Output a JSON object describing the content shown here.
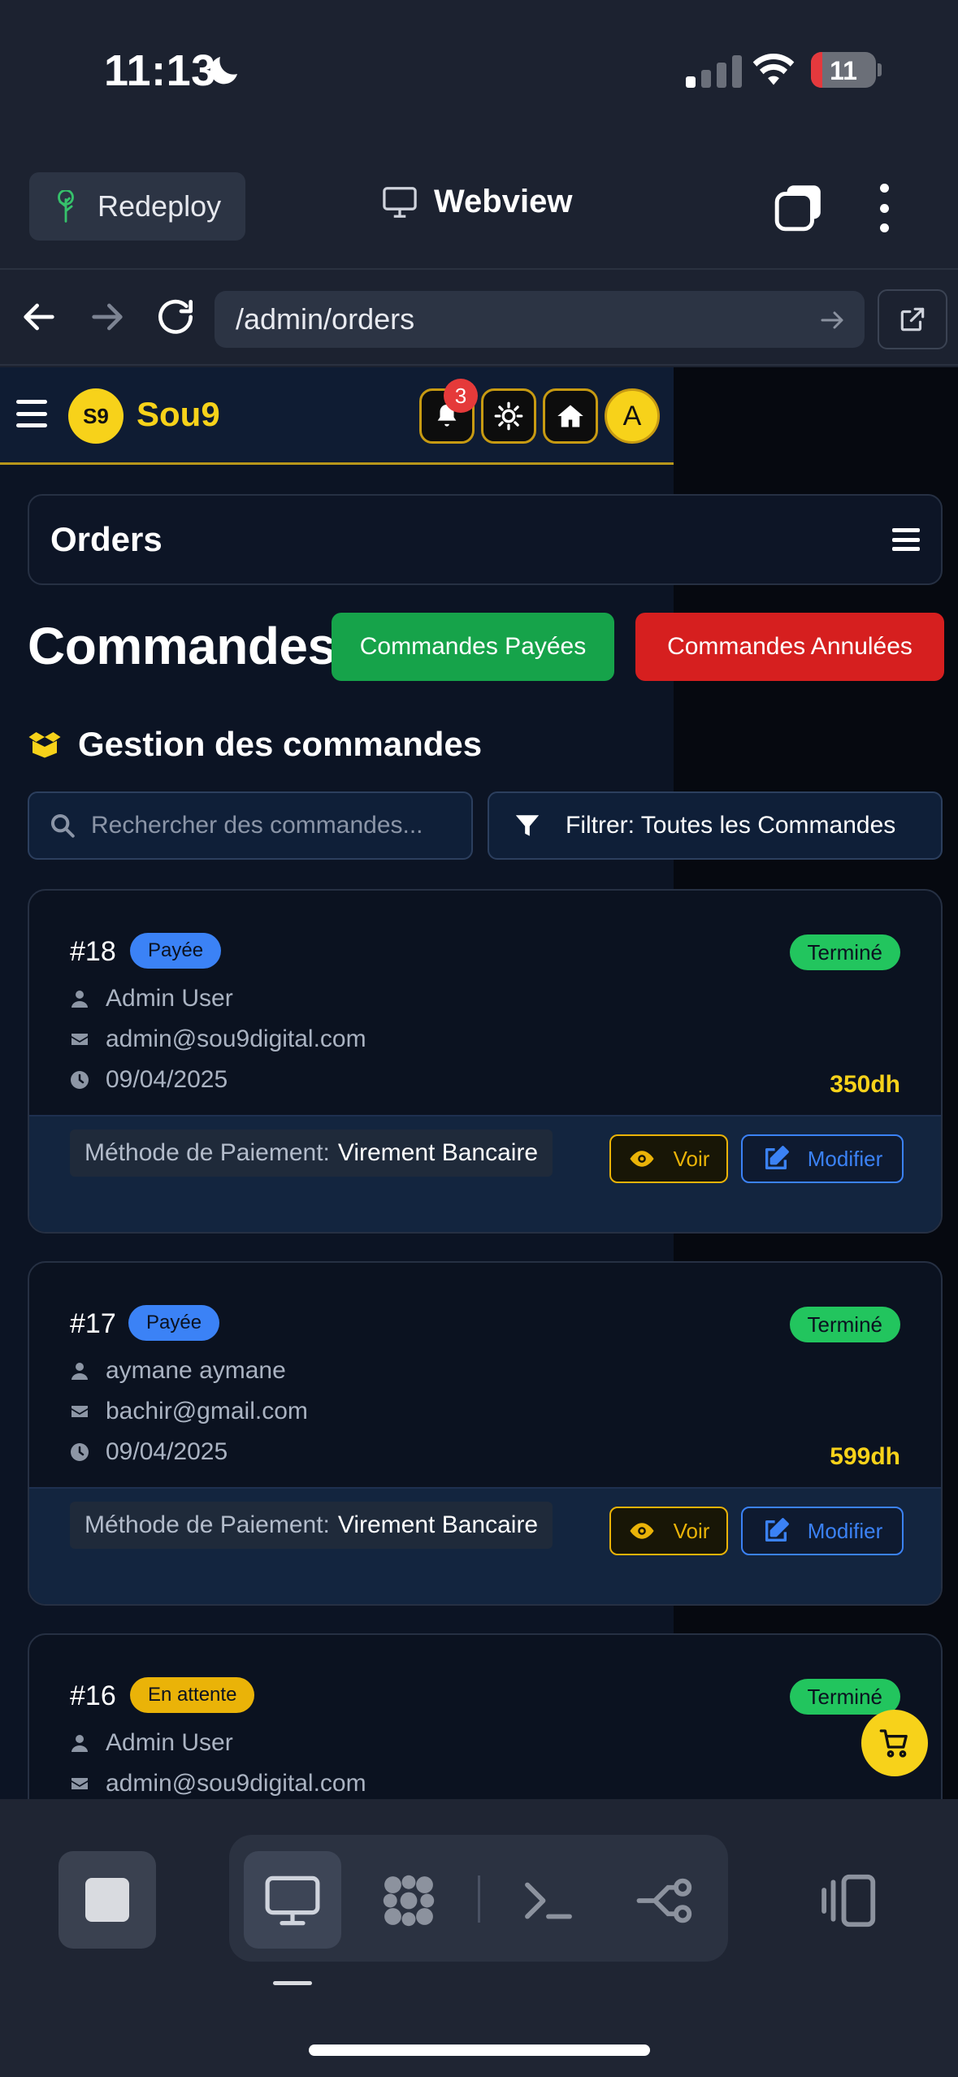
{
  "status_bar": {
    "time": "11:13",
    "battery": "11"
  },
  "app_header": {
    "redeploy_label": "Redeploy",
    "title": "Webview"
  },
  "browser": {
    "url": "/admin/orders"
  },
  "site": {
    "logo_badge": "S9",
    "logo_text": "Sou9",
    "notifications_count": "3",
    "avatar_initial": "A"
  },
  "page": {
    "bar_title": "Orders",
    "heading": "Commandes",
    "paid_button": "Commandes Payées",
    "cancelled_button": "Commandes Annulées",
    "section_title": "Gestion des commandes",
    "search_placeholder": "Rechercher des commandes...",
    "filter_label": "Filtrer: Toutes les Commandes"
  },
  "orders": [
    {
      "id": "#18",
      "payment_status": "Payée",
      "status": "Terminé",
      "customer": "Admin User",
      "email": "admin@sou9digital.com",
      "date": "09/04/2025",
      "total": "350dh",
      "payment_label": "Méthode de Paiement:",
      "payment_method": "Virement Bancaire",
      "view_label": "Voir",
      "edit_label": "Modifier"
    },
    {
      "id": "#17",
      "payment_status": "Payée",
      "status": "Terminé",
      "customer": "aymane aymane",
      "email": "bachir@gmail.com",
      "date": "09/04/2025",
      "total": "599dh",
      "payment_label": "Méthode de Paiement:",
      "payment_method": "Virement Bancaire",
      "view_label": "Voir",
      "edit_label": "Modifier"
    },
    {
      "id": "#16",
      "payment_status": "En attente",
      "status": "Terminé",
      "customer": "Admin User",
      "email": "admin@sou9digital.com"
    }
  ],
  "colors": {
    "accent_yellow": "#f7d21a",
    "paid_green": "#16a34a",
    "cancel_red": "#d61f1f",
    "status_blue": "#3b82f6",
    "done_green": "#22c55e"
  },
  "icons": {
    "status_bar": [
      "moon-icon",
      "signal-icon",
      "wifi-icon",
      "battery-icon"
    ],
    "header": [
      "tree-icon",
      "monitor-icon",
      "tabs-icon",
      "more-vertical-icon"
    ],
    "browser": [
      "back-arrow-icon",
      "forward-arrow-icon",
      "reload-icon",
      "go-arrow-icon",
      "external-link-icon"
    ],
    "site_nav": [
      "menu-icon",
      "bell-icon",
      "sun-icon",
      "home-icon"
    ],
    "toolbar": [
      "stop-icon",
      "monitor-icon",
      "grid-icon",
      "terminal-icon",
      "branch-icon",
      "panel-icon"
    ]
  }
}
